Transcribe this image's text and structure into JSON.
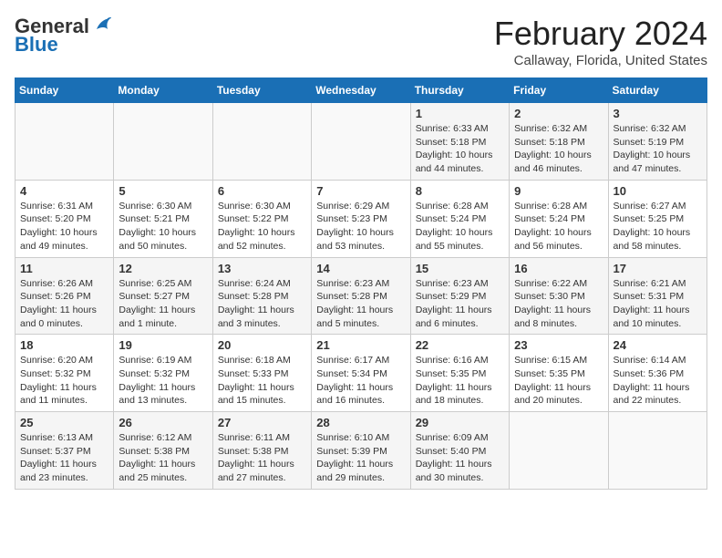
{
  "header": {
    "logo_general": "General",
    "logo_blue": "Blue",
    "month_title": "February 2024",
    "location": "Callaway, Florida, United States"
  },
  "weekdays": [
    "Sunday",
    "Monday",
    "Tuesday",
    "Wednesday",
    "Thursday",
    "Friday",
    "Saturday"
  ],
  "weeks": [
    [
      {
        "day": "",
        "info": ""
      },
      {
        "day": "",
        "info": ""
      },
      {
        "day": "",
        "info": ""
      },
      {
        "day": "",
        "info": ""
      },
      {
        "day": "1",
        "info": "Sunrise: 6:33 AM\nSunset: 5:18 PM\nDaylight: 10 hours\nand 44 minutes."
      },
      {
        "day": "2",
        "info": "Sunrise: 6:32 AM\nSunset: 5:18 PM\nDaylight: 10 hours\nand 46 minutes."
      },
      {
        "day": "3",
        "info": "Sunrise: 6:32 AM\nSunset: 5:19 PM\nDaylight: 10 hours\nand 47 minutes."
      }
    ],
    [
      {
        "day": "4",
        "info": "Sunrise: 6:31 AM\nSunset: 5:20 PM\nDaylight: 10 hours\nand 49 minutes."
      },
      {
        "day": "5",
        "info": "Sunrise: 6:30 AM\nSunset: 5:21 PM\nDaylight: 10 hours\nand 50 minutes."
      },
      {
        "day": "6",
        "info": "Sunrise: 6:30 AM\nSunset: 5:22 PM\nDaylight: 10 hours\nand 52 minutes."
      },
      {
        "day": "7",
        "info": "Sunrise: 6:29 AM\nSunset: 5:23 PM\nDaylight: 10 hours\nand 53 minutes."
      },
      {
        "day": "8",
        "info": "Sunrise: 6:28 AM\nSunset: 5:24 PM\nDaylight: 10 hours\nand 55 minutes."
      },
      {
        "day": "9",
        "info": "Sunrise: 6:28 AM\nSunset: 5:24 PM\nDaylight: 10 hours\nand 56 minutes."
      },
      {
        "day": "10",
        "info": "Sunrise: 6:27 AM\nSunset: 5:25 PM\nDaylight: 10 hours\nand 58 minutes."
      }
    ],
    [
      {
        "day": "11",
        "info": "Sunrise: 6:26 AM\nSunset: 5:26 PM\nDaylight: 11 hours\nand 0 minutes."
      },
      {
        "day": "12",
        "info": "Sunrise: 6:25 AM\nSunset: 5:27 PM\nDaylight: 11 hours\nand 1 minute."
      },
      {
        "day": "13",
        "info": "Sunrise: 6:24 AM\nSunset: 5:28 PM\nDaylight: 11 hours\nand 3 minutes."
      },
      {
        "day": "14",
        "info": "Sunrise: 6:23 AM\nSunset: 5:28 PM\nDaylight: 11 hours\nand 5 minutes."
      },
      {
        "day": "15",
        "info": "Sunrise: 6:23 AM\nSunset: 5:29 PM\nDaylight: 11 hours\nand 6 minutes."
      },
      {
        "day": "16",
        "info": "Sunrise: 6:22 AM\nSunset: 5:30 PM\nDaylight: 11 hours\nand 8 minutes."
      },
      {
        "day": "17",
        "info": "Sunrise: 6:21 AM\nSunset: 5:31 PM\nDaylight: 11 hours\nand 10 minutes."
      }
    ],
    [
      {
        "day": "18",
        "info": "Sunrise: 6:20 AM\nSunset: 5:32 PM\nDaylight: 11 hours\nand 11 minutes."
      },
      {
        "day": "19",
        "info": "Sunrise: 6:19 AM\nSunset: 5:32 PM\nDaylight: 11 hours\nand 13 minutes."
      },
      {
        "day": "20",
        "info": "Sunrise: 6:18 AM\nSunset: 5:33 PM\nDaylight: 11 hours\nand 15 minutes."
      },
      {
        "day": "21",
        "info": "Sunrise: 6:17 AM\nSunset: 5:34 PM\nDaylight: 11 hours\nand 16 minutes."
      },
      {
        "day": "22",
        "info": "Sunrise: 6:16 AM\nSunset: 5:35 PM\nDaylight: 11 hours\nand 18 minutes."
      },
      {
        "day": "23",
        "info": "Sunrise: 6:15 AM\nSunset: 5:35 PM\nDaylight: 11 hours\nand 20 minutes."
      },
      {
        "day": "24",
        "info": "Sunrise: 6:14 AM\nSunset: 5:36 PM\nDaylight: 11 hours\nand 22 minutes."
      }
    ],
    [
      {
        "day": "25",
        "info": "Sunrise: 6:13 AM\nSunset: 5:37 PM\nDaylight: 11 hours\nand 23 minutes."
      },
      {
        "day": "26",
        "info": "Sunrise: 6:12 AM\nSunset: 5:38 PM\nDaylight: 11 hours\nand 25 minutes."
      },
      {
        "day": "27",
        "info": "Sunrise: 6:11 AM\nSunset: 5:38 PM\nDaylight: 11 hours\nand 27 minutes."
      },
      {
        "day": "28",
        "info": "Sunrise: 6:10 AM\nSunset: 5:39 PM\nDaylight: 11 hours\nand 29 minutes."
      },
      {
        "day": "29",
        "info": "Sunrise: 6:09 AM\nSunset: 5:40 PM\nDaylight: 11 hours\nand 30 minutes."
      },
      {
        "day": "",
        "info": ""
      },
      {
        "day": "",
        "info": ""
      }
    ]
  ]
}
